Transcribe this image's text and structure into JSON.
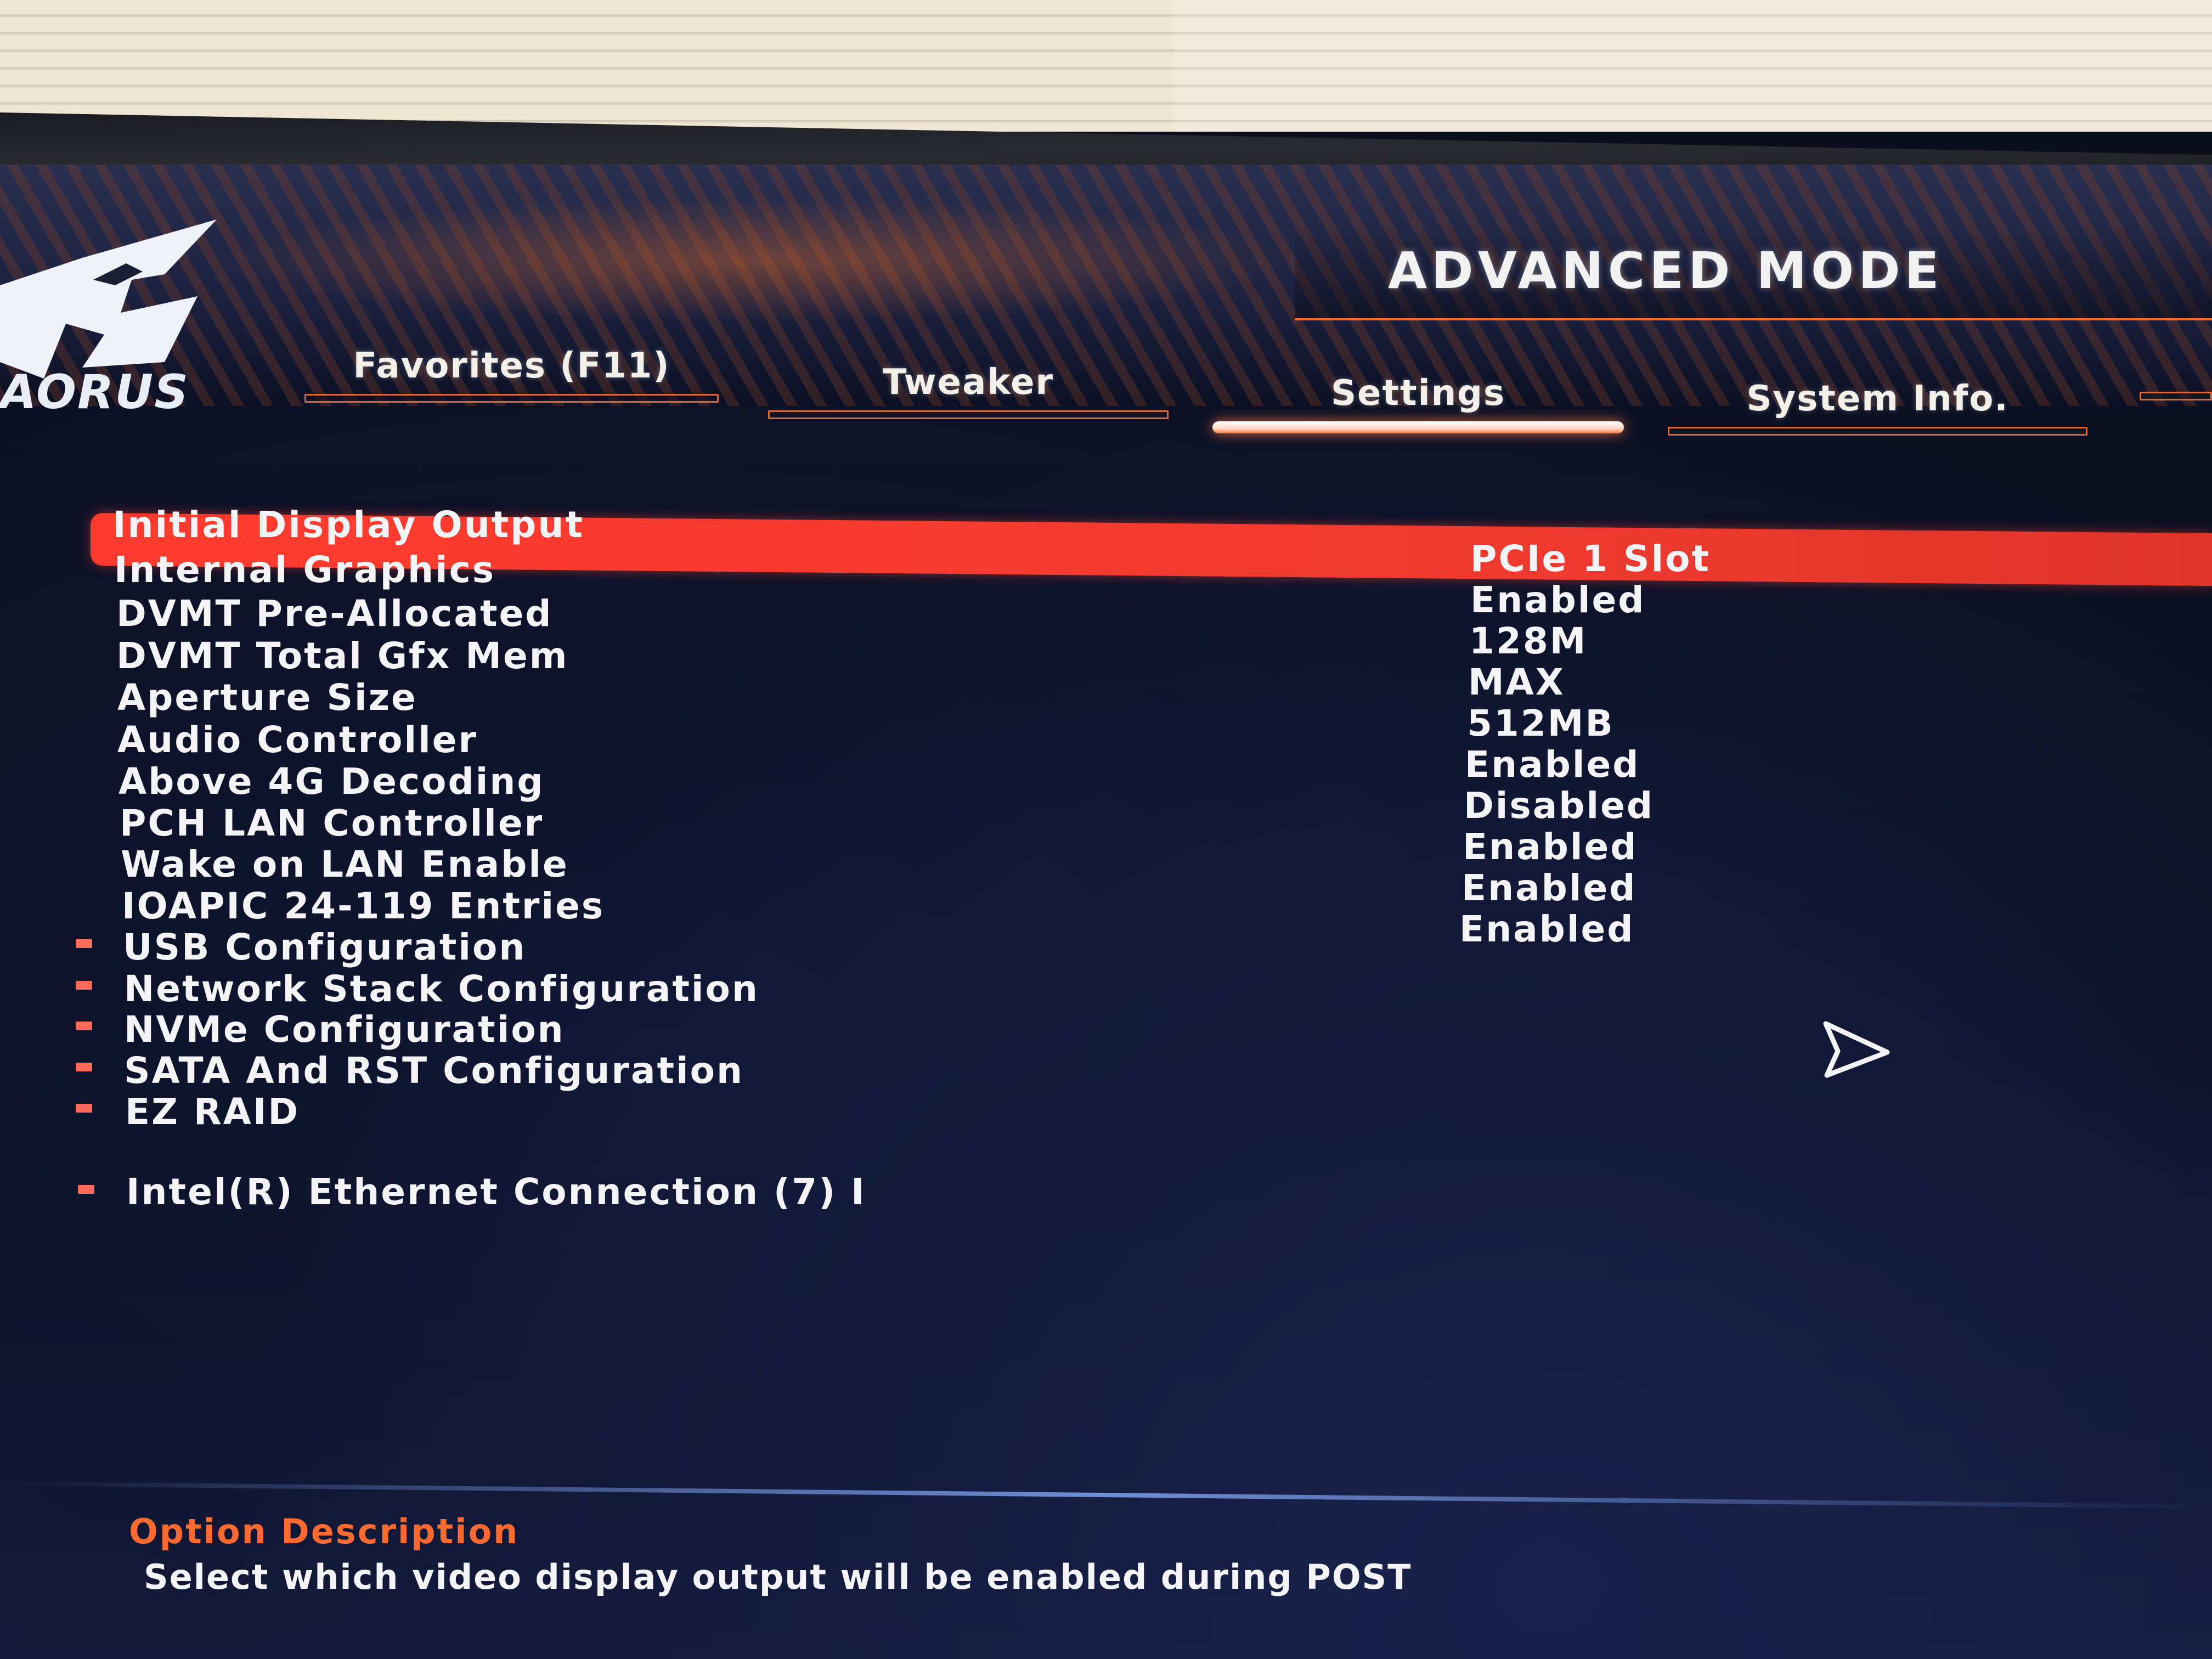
{
  "header": {
    "mode_title": "ADVANCED MODE",
    "logo_text": "AORUS"
  },
  "tabs": [
    {
      "label": "Favorites (F11)",
      "active": false
    },
    {
      "label": "Tweaker",
      "active": false
    },
    {
      "label": "Settings",
      "active": true
    },
    {
      "label": "System Info.",
      "active": false
    }
  ],
  "settings": [
    {
      "label": "Initial Display Output",
      "value": "PCIe 1 Slot",
      "selected": true
    },
    {
      "label": "Internal Graphics",
      "value": "Enabled"
    },
    {
      "label": "DVMT Pre-Allocated",
      "value": "128M"
    },
    {
      "label": "DVMT Total Gfx Mem",
      "value": "MAX"
    },
    {
      "label": "Aperture Size",
      "value": "512MB"
    },
    {
      "label": "Audio Controller",
      "value": "Enabled"
    },
    {
      "label": "Above 4G Decoding",
      "value": "Disabled"
    },
    {
      "label": "PCH LAN Controller",
      "value": "Enabled"
    },
    {
      "label": "Wake on LAN Enable",
      "value": "Enabled"
    },
    {
      "label": "IOAPIC 24-119 Entries",
      "value": "Enabled"
    }
  ],
  "submenus": [
    {
      "label": "USB Configuration"
    },
    {
      "label": "Network Stack Configuration"
    },
    {
      "label": "NVMe Configuration"
    },
    {
      "label": "SATA And RST Configuration"
    },
    {
      "label": "EZ RAID"
    },
    {
      "label": "Intel(R) Ethernet Connection (7) I"
    }
  ],
  "description": {
    "title": "Option Description",
    "text": "Select which video display output will be enabled during POST"
  },
  "colors": {
    "accent": "#ff3a2e",
    "tab_underline": "#d86a3a",
    "description_title": "#ff6a30",
    "text": "#f4f4f6",
    "background": "#0b0e1c"
  }
}
